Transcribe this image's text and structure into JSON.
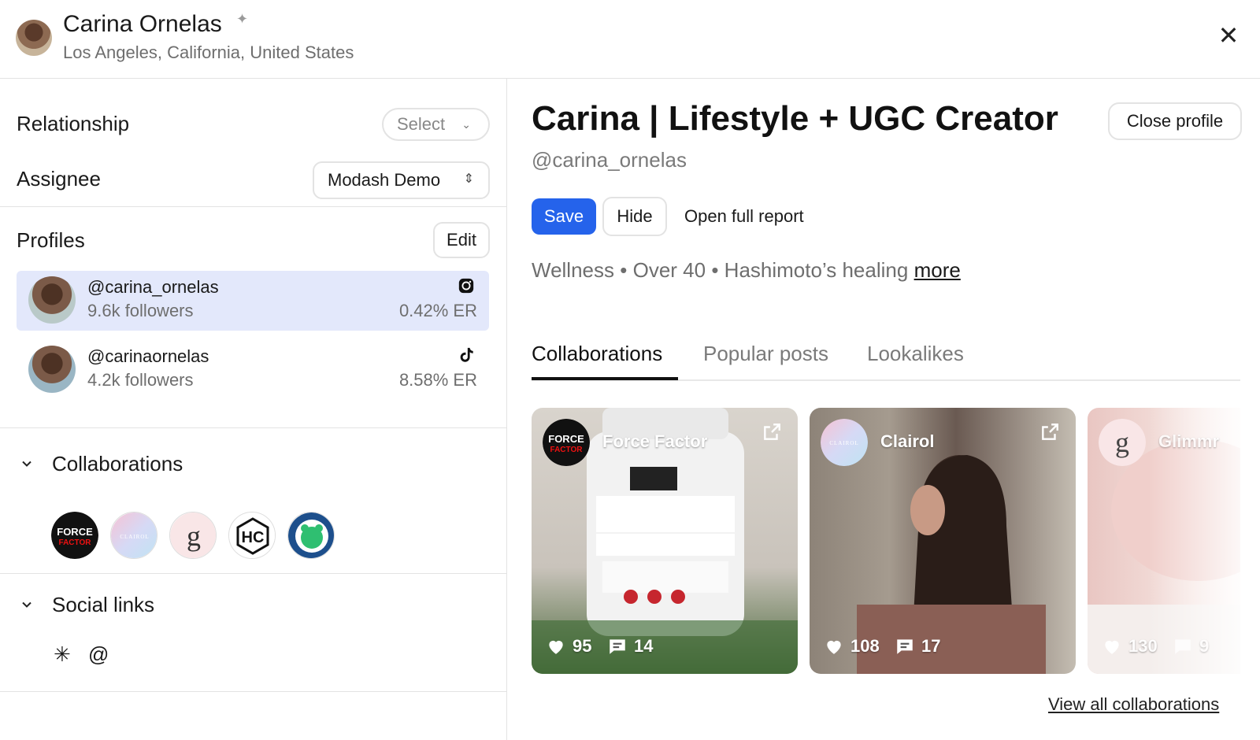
{
  "header": {
    "name": "Carina Ornelas",
    "location": "Los Angeles, California, United States"
  },
  "sidebar": {
    "relationship_label": "Relationship",
    "relationship_select": "Select",
    "assignee_label": "Assignee",
    "assignee_value": "Modash Demo",
    "profiles_title": "Profiles",
    "edit_label": "Edit",
    "profiles": [
      {
        "handle": "@carina_ornelas",
        "followers": "9.6k followers",
        "er": "0.42% ER",
        "network": "instagram-icon"
      },
      {
        "handle": "@carinaornelas",
        "followers": "4.2k followers",
        "er": "8.58% ER",
        "network": "tiktok-icon"
      }
    ],
    "collaborations_title": "Collaborations",
    "collab_logos": [
      "force-factor-logo",
      "clairol-logo",
      "glimmr-logo",
      "hc-logo",
      "build-a-bear-logo"
    ],
    "social_title": "Social links",
    "social_icons": [
      "linktree-icon",
      "threads-icon"
    ]
  },
  "main": {
    "title": "Carina | Lifestyle + UGC Creator",
    "username": "@carina_ornelas",
    "close_profile": "Close profile",
    "save": "Save",
    "hide": "Hide",
    "open_report": "Open full report",
    "tags": [
      "Wellness",
      "Over 40",
      "Hashimoto’s healing"
    ],
    "tag_separator": "•",
    "more": "more",
    "tabs": [
      "Collaborations",
      "Popular posts",
      "Lookalikes"
    ],
    "active_tab": "Collaborations",
    "cards": [
      {
        "brand": "Force Factor",
        "likes": "95",
        "comments": "14"
      },
      {
        "brand": "Clairol",
        "likes": "108",
        "comments": "17"
      },
      {
        "brand": "Glimmr",
        "likes": "130",
        "comments": "9"
      }
    ],
    "view_all": "View all collaborations"
  },
  "colors": {
    "accent": "#2563eb",
    "active_profile_bg": "#e3e8fb",
    "muted_text": "#6e6e6e",
    "border": "#e3e3e3"
  }
}
